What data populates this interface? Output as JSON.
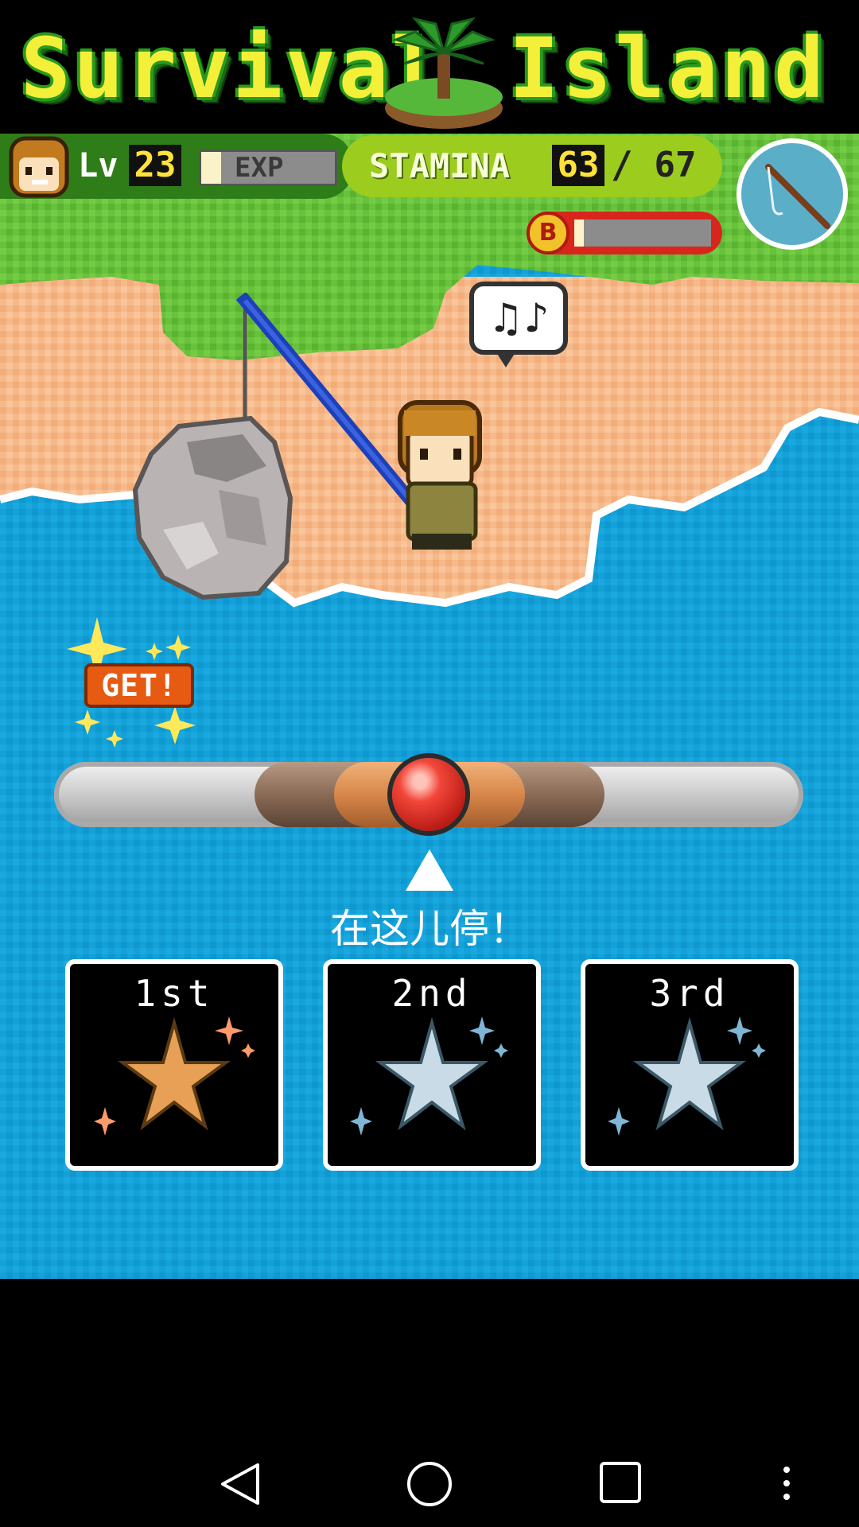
{
  "game": {
    "title_left": "Survival",
    "title_right": "Island"
  },
  "hud": {
    "level_label": "Lv",
    "level": "23",
    "exp_label": "EXP",
    "exp_fraction": 0.15,
    "stamina_label": "STAMINA",
    "stamina_current": "63",
    "stamina_separator": "/",
    "stamina_max": "67",
    "bonus_icon_letter": "B",
    "bonus_fraction": 0.07,
    "tool_icon": "fishing-rod-icon"
  },
  "scene": {
    "speech_bubble": "♫♪",
    "get_badge": "GET!"
  },
  "meter": {
    "knob_position": 0.5,
    "instruction": "在这儿停！"
  },
  "ranks": [
    {
      "label": "1st",
      "star_color": "#e7a055"
    },
    {
      "label": "2nd",
      "star_color": "#c9dbe6"
    },
    {
      "label": "3rd",
      "star_color": "#c9dbe6"
    }
  ],
  "nav": {
    "back_icon": "back-triangle-icon",
    "home_icon": "home-circle-icon",
    "recents_icon": "recents-square-icon",
    "menu_icon": "overflow-menu-icon"
  }
}
